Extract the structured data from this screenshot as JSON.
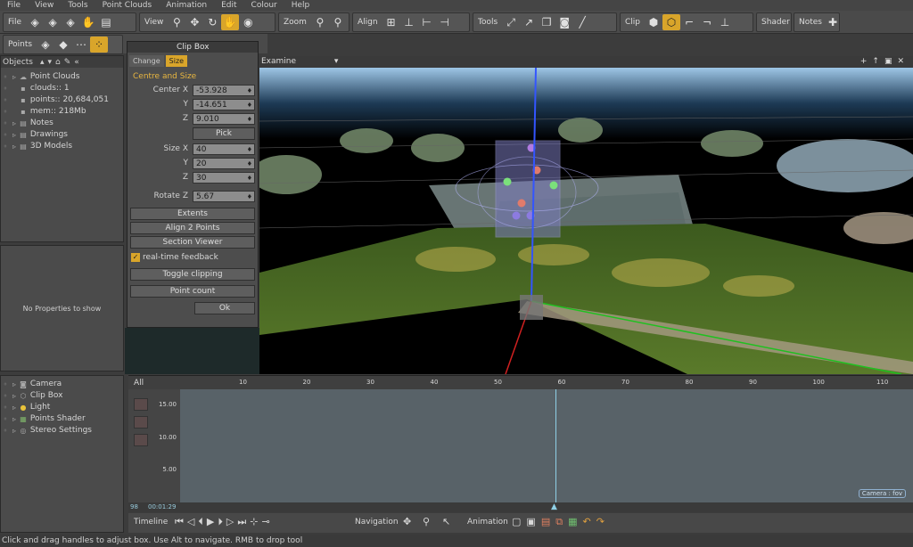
{
  "menu": [
    "File",
    "View",
    "Tools",
    "Point Clouds",
    "Animation",
    "Edit",
    "Colour",
    "Help"
  ],
  "toolbar": {
    "file": "File",
    "view": "View",
    "zoom": "Zoom",
    "align": "Align",
    "tools": "Tools",
    "clip": "Clip",
    "shader": "Shader",
    "notes": "Notes"
  },
  "toolbar2": {
    "points": "Points"
  },
  "objects": {
    "header": "Objects",
    "items": [
      "Point Clouds",
      "clouds:: 1",
      "points:: 20,684,051",
      "mem:: 218Mb",
      "Notes",
      "Drawings",
      "3D Models"
    ]
  },
  "properties": {
    "empty": "No Properties to show"
  },
  "scene": {
    "items": [
      "Camera",
      "Clip Box",
      "Light",
      "Points Shader",
      "Stereo Settings"
    ]
  },
  "clipbox": {
    "title": "Clip Box",
    "tabs": [
      "Change",
      "Size"
    ],
    "section": "Centre and Size",
    "center": {
      "label": "Center X",
      "x": "-53.928",
      "y": "-14.651",
      "z": "9.010"
    },
    "ylabel": "Y",
    "zlabel": "Z",
    "pick": "Pick",
    "size": {
      "label": "Size X",
      "x": "40",
      "y": "20",
      "z": "30"
    },
    "rotate": {
      "label": "Rotate Z",
      "value": "5.67"
    },
    "buttons": [
      "Extents",
      "Align 2 Points",
      "Section Viewer"
    ],
    "feedback": "real-time feedback",
    "toggle": "Toggle clipping",
    "count": "Point count",
    "ok": "Ok"
  },
  "viewport": {
    "mode": "Examine"
  },
  "timeline": {
    "all": "All",
    "ticks": [
      "10",
      "20",
      "30",
      "40",
      "50",
      "60",
      "70",
      "80",
      "90",
      "100",
      "110"
    ],
    "y": [
      "15.00",
      "10.00",
      "5.00"
    ],
    "start": "98",
    "time": "00:01:29",
    "camera_label": "Camera : fov",
    "bar": {
      "timeline": "Timeline",
      "navigation": "Navigation",
      "animation": "Animation"
    }
  },
  "status": "Click and drag handles to adjust box. Use Alt to navigate. RMB to drop tool"
}
